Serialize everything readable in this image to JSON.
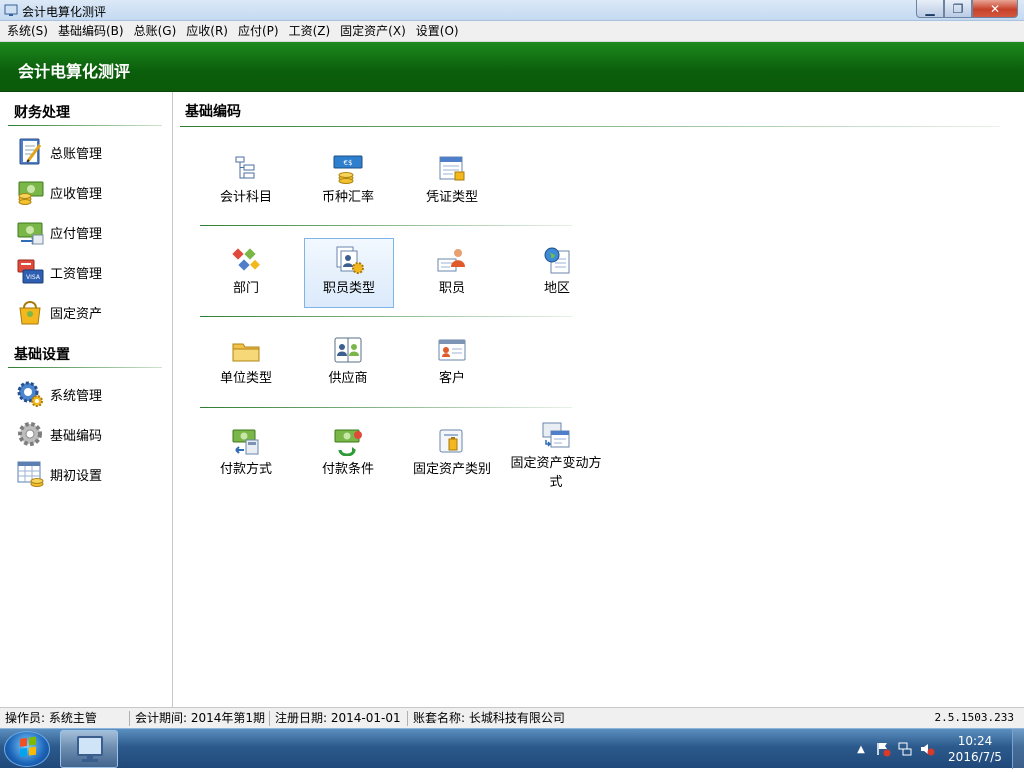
{
  "window": {
    "title": "会计电算化测评"
  },
  "menu": [
    "系统(S)",
    "基础编码(B)",
    "总账(G)",
    "应收(R)",
    "应付(P)",
    "工资(Z)",
    "固定资产(X)",
    "设置(O)"
  ],
  "header": {
    "title": "会计电算化测评"
  },
  "sidebar": {
    "sections": [
      {
        "title": "财务处理",
        "items": [
          {
            "label": "总账管理",
            "icon": "ledger-icon"
          },
          {
            "label": "应收管理",
            "icon": "receivable-icon"
          },
          {
            "label": "应付管理",
            "icon": "payable-icon"
          },
          {
            "label": "工资管理",
            "icon": "salary-icon"
          },
          {
            "label": "固定资产",
            "icon": "fixed-asset-icon"
          }
        ]
      },
      {
        "title": "基础设置",
        "items": [
          {
            "label": "系统管理",
            "icon": "system-gear-icon"
          },
          {
            "label": "基础编码",
            "icon": "basic-code-gear-icon"
          },
          {
            "label": "期初设置",
            "icon": "opening-balance-icon"
          }
        ]
      }
    ]
  },
  "main": {
    "title": "基础编码",
    "groups": [
      {
        "items": [
          {
            "label": "会计科目",
            "icon": "account-tree-icon"
          },
          {
            "label": "币种汇率",
            "icon": "currency-rate-icon"
          },
          {
            "label": "凭证类型",
            "icon": "voucher-type-icon"
          }
        ]
      },
      {
        "items": [
          {
            "label": "部门",
            "icon": "department-icon"
          },
          {
            "label": "职员类型",
            "icon": "employee-type-icon",
            "selected": true
          },
          {
            "label": "职员",
            "icon": "employee-icon"
          },
          {
            "label": "地区",
            "icon": "region-icon"
          }
        ]
      },
      {
        "items": [
          {
            "label": "单位类型",
            "icon": "unit-type-icon"
          },
          {
            "label": "供应商",
            "icon": "supplier-icon"
          },
          {
            "label": "客户",
            "icon": "customer-icon"
          }
        ]
      },
      {
        "items": [
          {
            "label": "付款方式",
            "icon": "payment-method-icon"
          },
          {
            "label": "付款条件",
            "icon": "payment-terms-icon"
          },
          {
            "label": "固定资产类别",
            "icon": "asset-category-icon"
          },
          {
            "label": "固定资产变动方式",
            "icon": "asset-change-icon"
          }
        ]
      }
    ]
  },
  "status": {
    "operator": "操作员: 系统主管",
    "period": "会计期间: 2014年第1期",
    "reg_date": "注册日期: 2014-01-01",
    "account_set": "账套名称: 长城科技有限公司",
    "version": "2.5.1503.233"
  },
  "taskbar": {
    "time": "10:24",
    "date": "2016/7/5"
  },
  "colors": {
    "header_green": "#0b5e0b",
    "accent_line": "#2e7d32",
    "selected_border": "#7eb4ea"
  }
}
